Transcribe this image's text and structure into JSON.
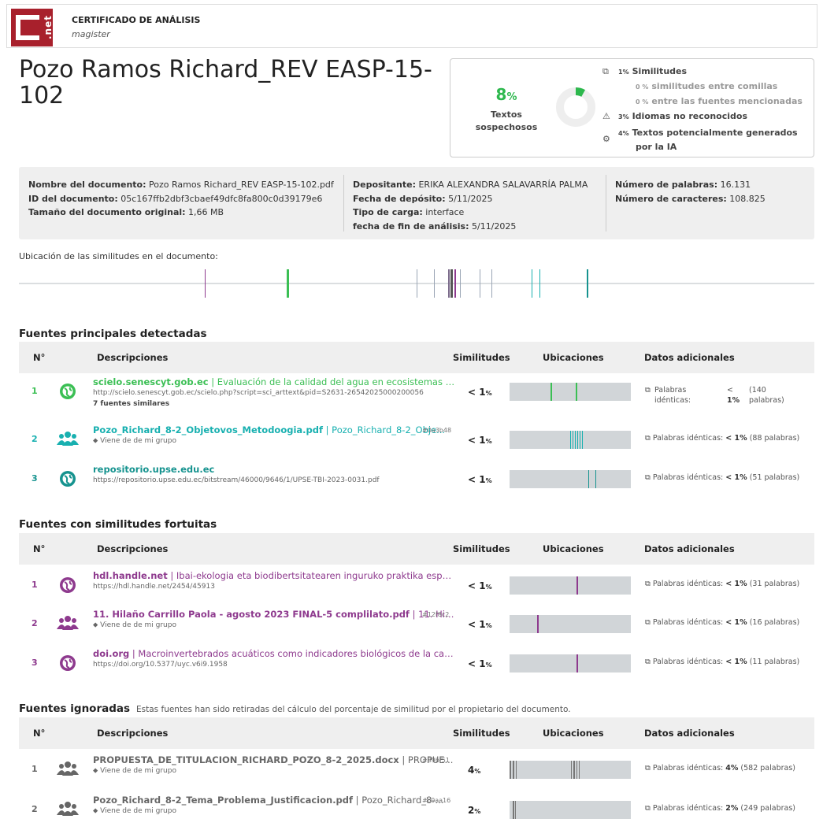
{
  "header": {
    "title": "CERTIFICADO DE ANÁLISIS",
    "subtitle": "magister",
    "logo_text": ".net"
  },
  "document_title": "Pozo Ramos Richard_REV EASP-15-102",
  "summary": {
    "percent": "8",
    "percent_sign": "%",
    "label": "Textos sospechosos",
    "donut_fraction": 0.08,
    "accent": "#2db84d",
    "stats": [
      {
        "pct": "1%",
        "label": "Similitudes",
        "icon": "copy-icon"
      },
      {
        "pct": "0 %",
        "label": "similitudes entre comillas"
      },
      {
        "pct": "0 %",
        "label": "entre las fuentes mencionadas"
      },
      {
        "pct": "3%",
        "label": "Idiomas no reconocidos",
        "icon": "warning-icon"
      },
      {
        "pct": "4%",
        "label": "Textos potencialmente generados",
        "label2": "por la IA",
        "icon": "ai-chip-icon"
      }
    ]
  },
  "meta": {
    "col1": [
      {
        "k": "Nombre del documento:",
        "v": "Pozo Ramos Richard_REV EASP-15-102.pdf"
      },
      {
        "k": "ID del documento:",
        "v": "05c167ffb2dbf3cbaef49dfc8fa800c0d39179e6"
      },
      {
        "k": "Tamaño del documento original:",
        "v": "1,66 MB"
      }
    ],
    "col2": [
      {
        "k": "Depositante:",
        "v": "ERIKA ALEXANDRA SALAVARRÍA PALMA"
      },
      {
        "k": "Fecha de depósito:",
        "v": "5/11/2025"
      },
      {
        "k": "Tipo de carga:",
        "v": "interface"
      },
      {
        "k": "fecha de fin de análisis:",
        "v": "5/11/2025"
      }
    ],
    "col3": [
      {
        "k": "Número de palabras:",
        "v": "16.131"
      },
      {
        "k": "Número de caracteres:",
        "v": "108.825"
      }
    ]
  },
  "location": {
    "label": "Ubicación de las similitudes en el documento:"
  },
  "table_headers": {
    "num": "N°",
    "desc": "Descripciones",
    "sim": "Similitudes",
    "ubic": "Ubicaciones",
    "datos": "Datos adicionales"
  },
  "sections": {
    "principales": {
      "title": "Fuentes principales detectadas",
      "rows": [
        {
          "num": "1",
          "title": "scielo.senescyt.gob.ec",
          "rest": " | Evaluación de la calidad del agua en ecosistemas altoan...",
          "url": "http://scielo.senescyt.gob.ec/scielo.php?script=sci_arttext&pid=S2631-26542025000200056",
          "extra": "7 fuentes similares",
          "sim": "< 1",
          "sim_unit": "%",
          "color": "#3bbf54",
          "icon": "globe-icon",
          "datos_a": "Palabras",
          "datos_b": "idénticas:",
          "datos_c": "<",
          "datos_d": "1%",
          "datos_e": "(140",
          "datos_f": "palabras)"
        },
        {
          "num": "2",
          "title": "Pozo_Richard_8-2_Objetovos_Metodoogia.pdf",
          "rest": " | Pozo_Richard_8-2_Obje...",
          "hash": "#0a3b48",
          "group": "Viene de de mi grupo",
          "sim": "< 1",
          "sim_unit": "%",
          "color": "#18b0b0",
          "icon": "group-icon",
          "datos_k": "Palabras idénticas:",
          "datos_v": "< 1%",
          "datos_n": "(88 palabras)"
        },
        {
          "num": "3",
          "title": "repositorio.upse.edu.ec",
          "rest": "",
          "url": "https://repositorio.upse.edu.ec/bitstream/46000/9646/1/UPSE-TBI-2023-0031.pdf",
          "sim": "< 1",
          "sim_unit": "%",
          "color": "#16938f",
          "icon": "globe-icon",
          "datos_k": "Palabras idénticas:",
          "datos_v": "< 1%",
          "datos_n": "(51 palabras)"
        }
      ]
    },
    "fortuitas": {
      "title": "Fuentes con similitudes fortuitas",
      "rows": [
        {
          "num": "1",
          "title": "hdl.handle.net",
          "rest": " | Ibai-ekologia eta biodibertsitatearen inguruko praktika esperime...",
          "url": "https://hdl.handle.net/2454/45913",
          "sim": "< 1",
          "sim_unit": "%",
          "color": "#8e3a8e",
          "icon": "globe-icon",
          "datos_k": "Palabras idénticas:",
          "datos_v": "< 1%",
          "datos_n": "(31 palabras)"
        },
        {
          "num": "2",
          "title": "11. Hilaño Carrillo Paola - agosto 2023 FINAL-5 complilato.pdf",
          "rest": " | 11. Hil...",
          "hash": "#12f8c2",
          "group": "Viene de de mi grupo",
          "sim": "< 1",
          "sim_unit": "%",
          "color": "#8e3a8e",
          "icon": "group-icon",
          "datos_k": "Palabras idénticas:",
          "datos_v": "< 1%",
          "datos_n": "(16 palabras)"
        },
        {
          "num": "3",
          "title": "doi.org",
          "rest": " | Macroinvertebrados acuáticos como indicadores biológicos de la calidad...",
          "url": "https://doi.org/10.5377/uyc.v6i9.1958",
          "sim": "< 1",
          "sim_unit": "%",
          "color": "#8e3a8e",
          "icon": "globe-icon",
          "datos_k": "Palabras idénticas:",
          "datos_v": "< 1%",
          "datos_n": "(11 palabras)"
        }
      ]
    },
    "ignoradas": {
      "title": "Fuentes ignoradas",
      "note": "Estas fuentes han sido retiradas del cálculo del porcentaje de similitud por el propietario del documento.",
      "rows": [
        {
          "num": "1",
          "title": "PROPUESTA_DE_TITULACION_RICHARD_POZO_8-2_2025.docx",
          "rest": " | PROPUE...",
          "hash": "#89bf51",
          "group": "Viene de de mi grupo",
          "sim": "4",
          "sim_unit": "%",
          "color": "#666",
          "icon": "group-icon",
          "datos_k": "Palabras idénticas:",
          "datos_v": "4%",
          "datos_n": "(582 palabras)"
        },
        {
          "num": "2",
          "title": "Pozo_Richard_8-2_Tema_Problema_Justificacion.pdf",
          "rest": " | Pozo_Richard_8-...",
          "hash": "#c0aa16",
          "group": "Viene de de mi grupo",
          "sim": "2",
          "sim_unit": "%",
          "color": "#666",
          "icon": "group-icon",
          "datos_k": "Palabras idénticas:",
          "datos_v": "2%",
          "datos_n": "(249 palabras)"
        }
      ]
    }
  }
}
